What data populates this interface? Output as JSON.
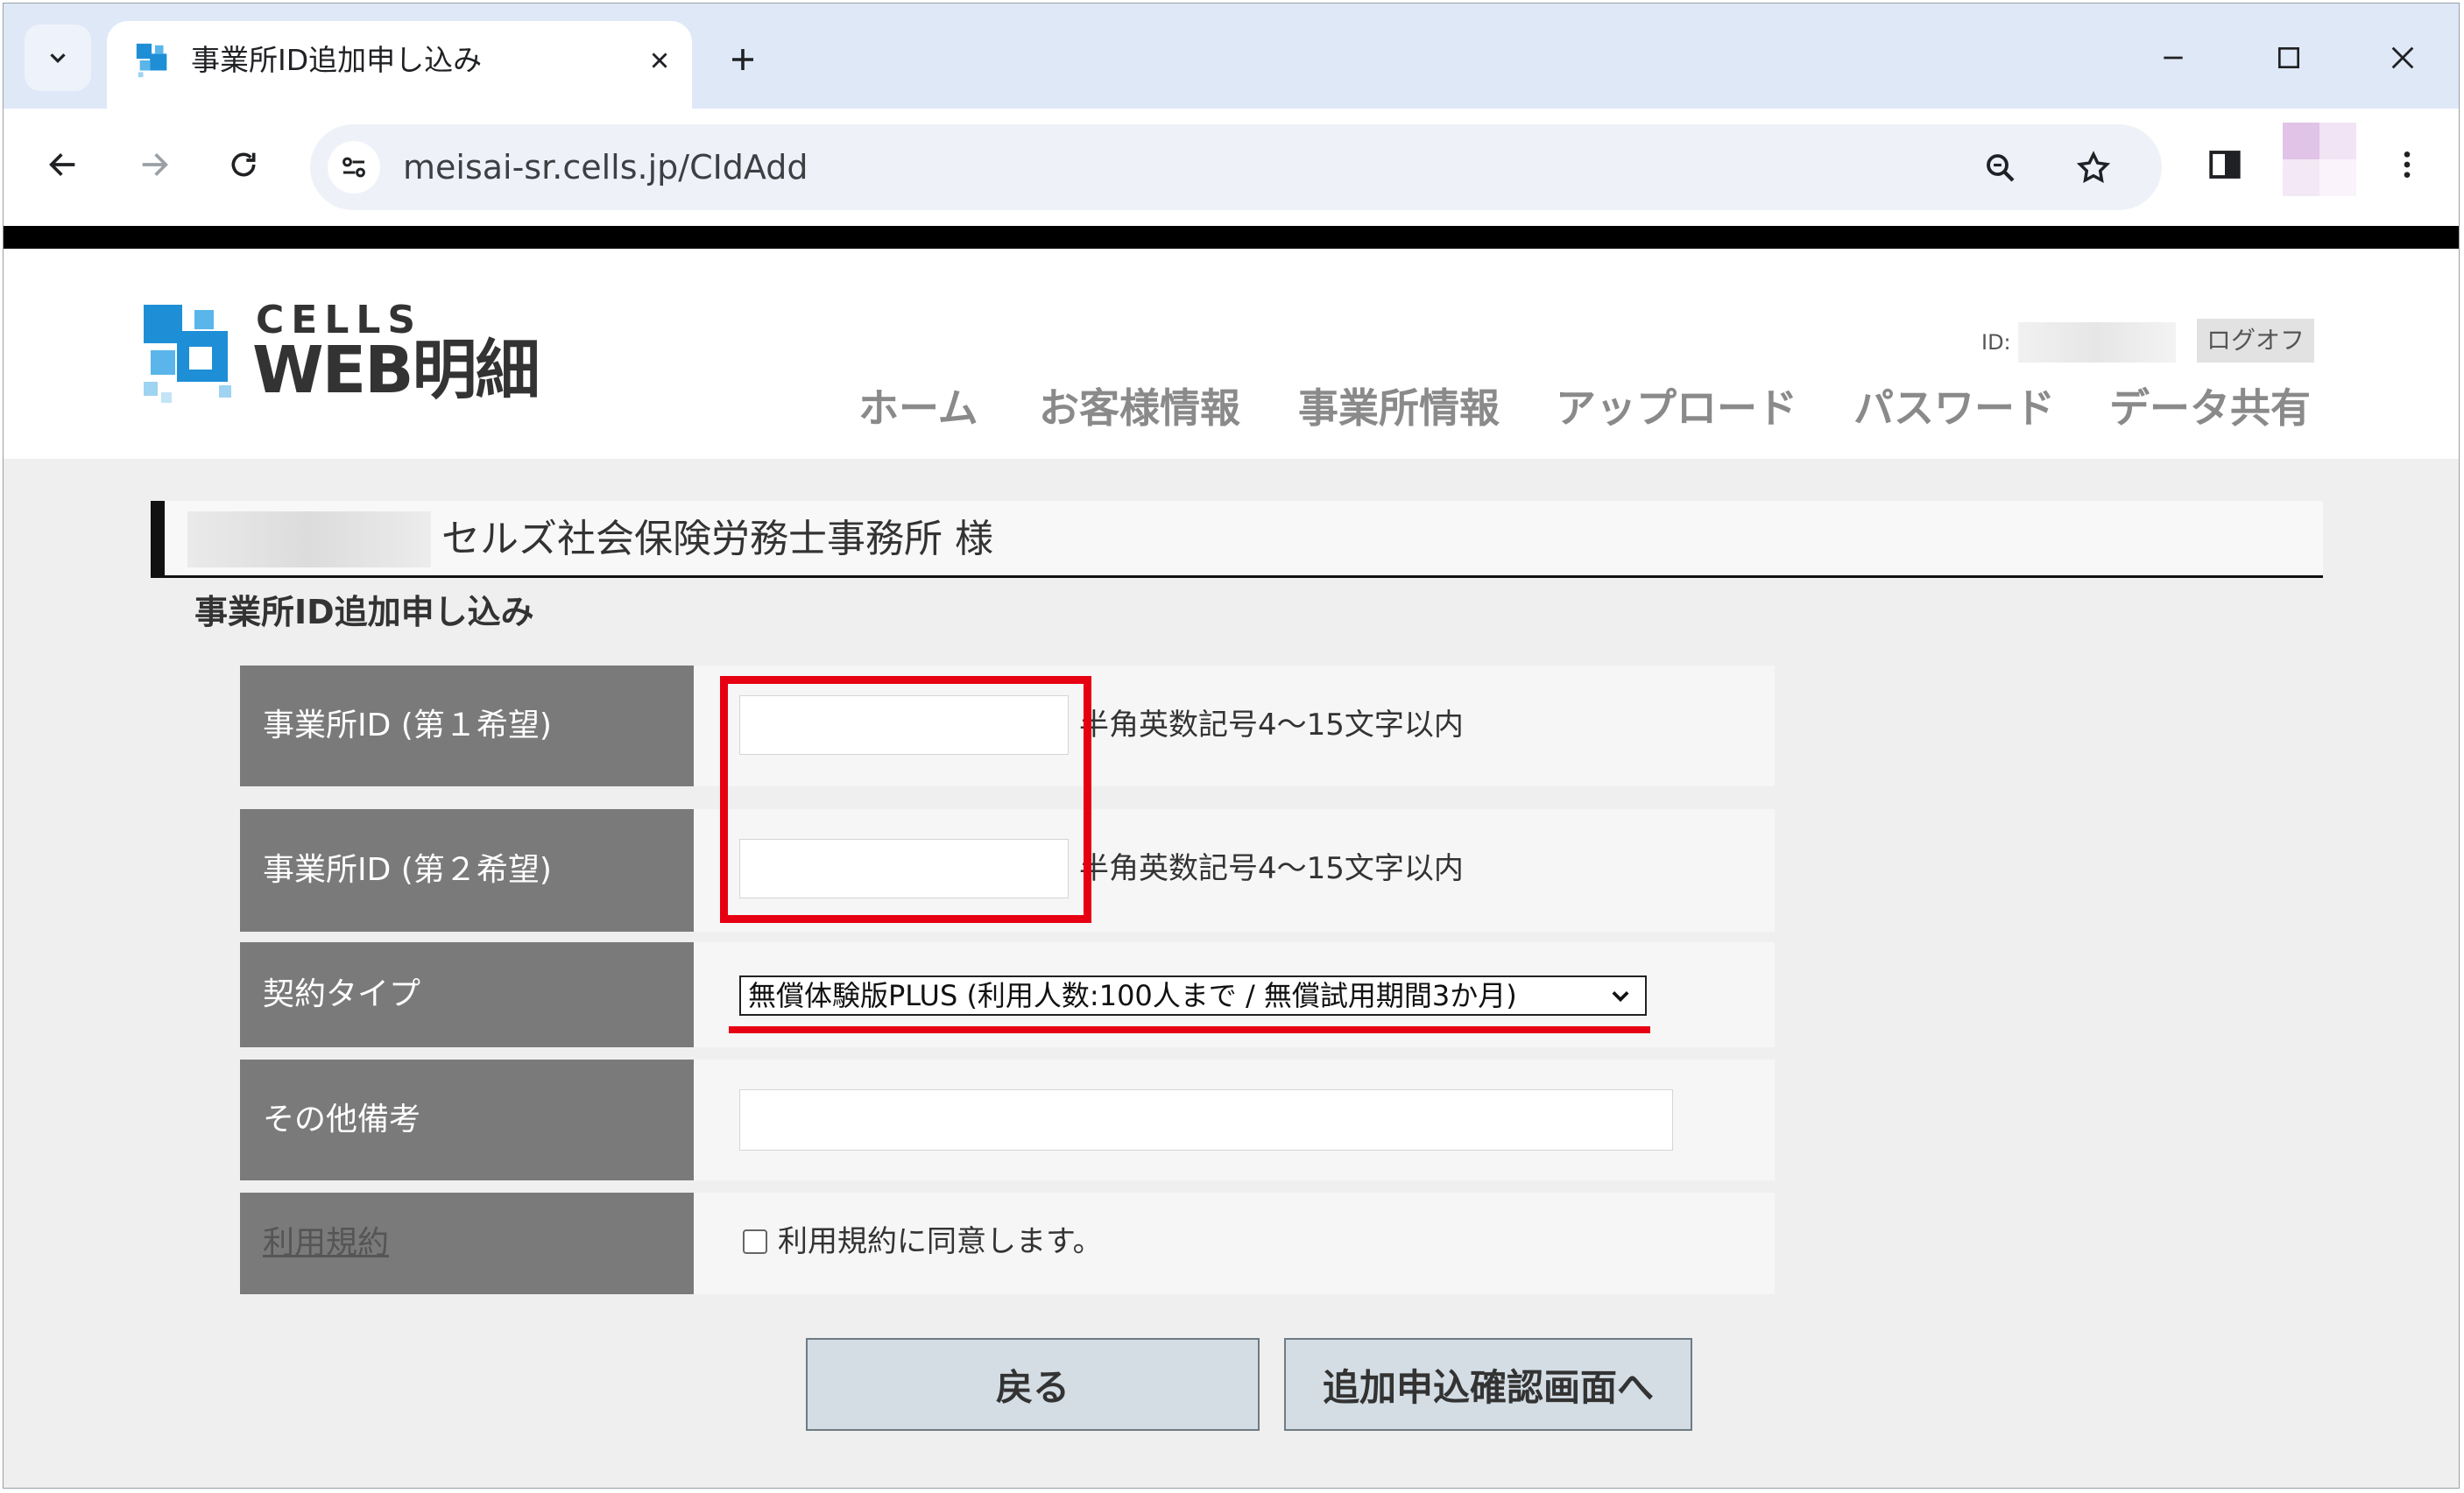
{
  "browser": {
    "tab_title": "事業所ID追加申し込み",
    "url": "meisai-sr.cells.jp/CIdAdd"
  },
  "header": {
    "logo_cells": "CELLS",
    "logo_webmeisai": "WEB明細",
    "user_id_label": "ID:",
    "logoff_label": "ログオフ",
    "nav": [
      "ホーム",
      "お客様情報",
      "事業所情報",
      "アップロード",
      "パスワード",
      "データ共有"
    ]
  },
  "content": {
    "customer_name": "セルズ社会保険労務士事務所 様",
    "section_title": "事業所ID追加申し込み",
    "rows": {
      "id1": {
        "label": "事業所ID (第１希望)",
        "value": "",
        "hint": "半角英数記号4～15文字以内"
      },
      "id2": {
        "label": "事業所ID (第２希望)",
        "value": "",
        "hint": "半角英数記号4～15文字以内"
      },
      "contract": {
        "label": "契約タイプ",
        "selected": "無償体験版PLUS (利用人数:100人まで / 無償試用期間3か月)"
      },
      "notes": {
        "label": "その他備考",
        "value": ""
      },
      "terms": {
        "label": "利用規約",
        "agree_label": "利用規約に同意します。",
        "checked": false
      }
    },
    "buttons": {
      "back": "戻る",
      "confirm": "追加申込確認画面へ"
    }
  },
  "colors": {
    "accent_red": "#e60012",
    "label_gray": "#7a7a7a",
    "logo_blue": "#1e8fd6"
  }
}
